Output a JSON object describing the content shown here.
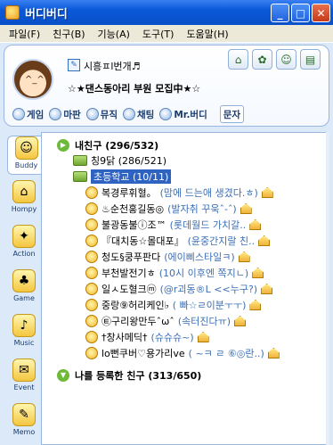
{
  "window": {
    "title": "버디버디",
    "min": "_",
    "max": "□",
    "close": "✕"
  },
  "menu": [
    "파일(F)",
    "친구(B)",
    "기능(A)",
    "도구(T)",
    "도움말(H)"
  ],
  "profile": {
    "nickname": "시흥ㅍl번개♬",
    "status": "☆★댄스동아리 부원 모집中★☆",
    "avatar_face": "^_^"
  },
  "tool_icons": [
    "home-icon",
    "settings-icon",
    "person-icon",
    "memo-icon"
  ],
  "quick_buttons": [
    "게임",
    "마판",
    "뮤직",
    "채팅",
    "Mr.버디",
    "문자"
  ],
  "sidebar": [
    {
      "label": "Buddy",
      "icon": "☺"
    },
    {
      "label": "Hompy",
      "icon": "⌂"
    },
    {
      "label": "Action",
      "icon": "✦"
    },
    {
      "label": "Game",
      "icon": "♣"
    },
    {
      "label": "Music",
      "icon": "♪"
    },
    {
      "label": "Event",
      "icon": "✉"
    },
    {
      "label": "Memo",
      "icon": "✎"
    }
  ],
  "buddy_list": {
    "my_friends": "내친구 (296/532)",
    "groups": [
      {
        "label": "칭9닭 (286/521)"
      },
      {
        "label": "초등학교 (10/11)",
        "selected": true
      }
    ],
    "friends": [
      {
        "name": "복경루휘혈。",
        "msg": "(맘에 드는애 생겼다.ㅎ)"
      },
      {
        "name": "♨순천홍길동◎",
        "msg": "(발자취 꾸욱ˆ-ˆ)"
      },
      {
        "name": "불광동불ⓘ조™",
        "msg": "(롯데월드 가치갈.."
      },
      {
        "name": "『대치동☆몰대포』",
        "msg": "(윤중간지랄 친.."
      },
      {
        "name": "청도§쿵푸판다",
        "msg": "(에이삐스타일ㅋ)"
      },
      {
        "name": "부천발전기ㅎ",
        "msg": "(10시 이후엔 쪽지ㄴ)"
      },
      {
        "name": "일ㅅ도혈크ⓜ",
        "msg": "(@r괴동®L <<누구?)"
      },
      {
        "name": "중랑⑨허리케인♭",
        "msg": "( 빠☆ㄹ이분ㅜㅜ)"
      },
      {
        "name": "㉫구리왕만두ˆωˆ",
        "msg": "(속터진다ㅠ)"
      },
      {
        "name": "†창사메딕†",
        "msg": "(슈슈슈~)"
      },
      {
        "name": "lo뻔쿠버♡용가리ve",
        "msg": "( ~ㅋ ㄹ ⑥◎란..)"
      }
    ],
    "registered": "나를 등록한 친구 (313/650)"
  },
  "colors": {
    "accent": "#2f63c2",
    "title_bar": "#0a58d8",
    "msg_text": "#3b6fb6"
  }
}
